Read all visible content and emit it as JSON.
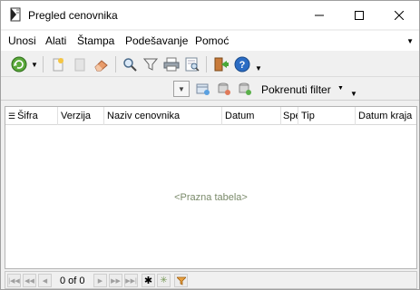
{
  "window": {
    "title": "Pregled cenovnika",
    "minimize": "minimize",
    "maximize": "maximize",
    "close": "close"
  },
  "menu": {
    "items": [
      {
        "label": "Unosi"
      },
      {
        "label": "Alati"
      },
      {
        "label": "Štampa"
      },
      {
        "label": "Podešavanje"
      },
      {
        "label": "Pomoć"
      }
    ]
  },
  "toolbar": {
    "icons": [
      "refresh-icon",
      "new-icon",
      "delete-icon",
      "eraser-icon",
      "search-icon",
      "filter-icon",
      "print-icon",
      "print-preview-icon",
      "exit-icon",
      "help-icon"
    ]
  },
  "toolbar2": {
    "filter_label": "Pokrenuti filter"
  },
  "grid": {
    "columns": [
      "Šifra",
      "Verzija",
      "Naziv cenovnika",
      "Datum",
      "Spe",
      "Tip",
      "Datum kraja"
    ],
    "empty_text": "<Prazna tabela>"
  },
  "navigator": {
    "count_text": "0 of 0"
  },
  "colors": {
    "accent": "#3a6fc4",
    "help": "#2b6cc4"
  }
}
